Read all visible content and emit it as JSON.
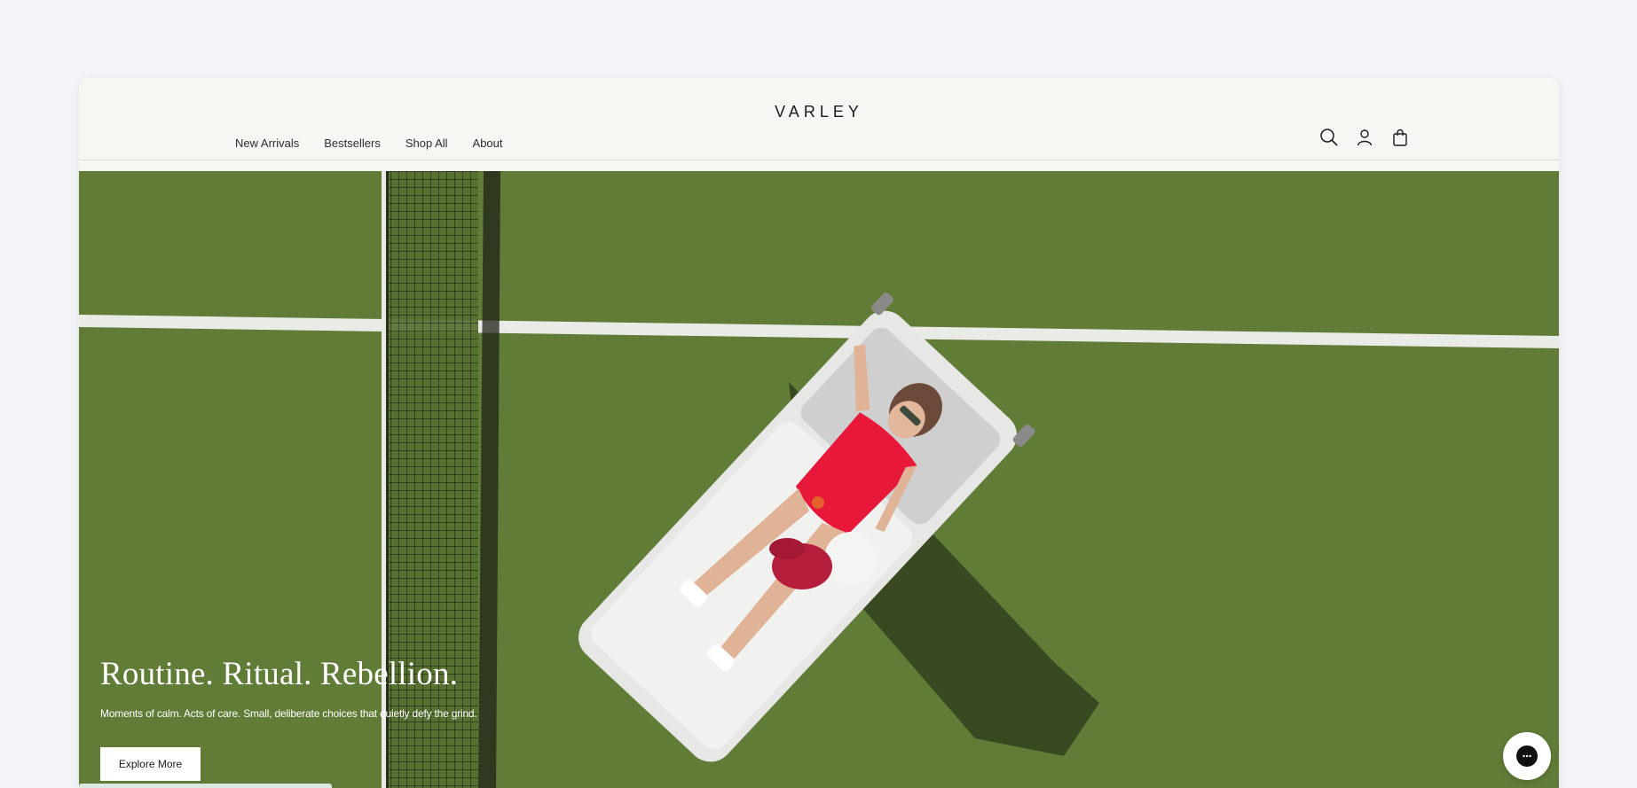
{
  "header": {
    "logo": "VARLEY",
    "nav": [
      "New Arrivals",
      "Bestsellers",
      "Shop All",
      "About"
    ],
    "icons": [
      "search-icon",
      "account-icon",
      "bag-icon"
    ]
  },
  "hero": {
    "title": "Routine. Ritual. Rebellion.",
    "subtitle": "Moments of calm. Acts of care. Small, deliberate choices that quietly defy the grind.",
    "cta_label": "Explore More"
  },
  "chat": {
    "icon": "chat-icon"
  },
  "colors": {
    "page_bg": "#f3f4f8",
    "header_bg": "#f7f6f2",
    "court_green": "#5f7a35",
    "swimsuit_red": "#e8183a"
  }
}
